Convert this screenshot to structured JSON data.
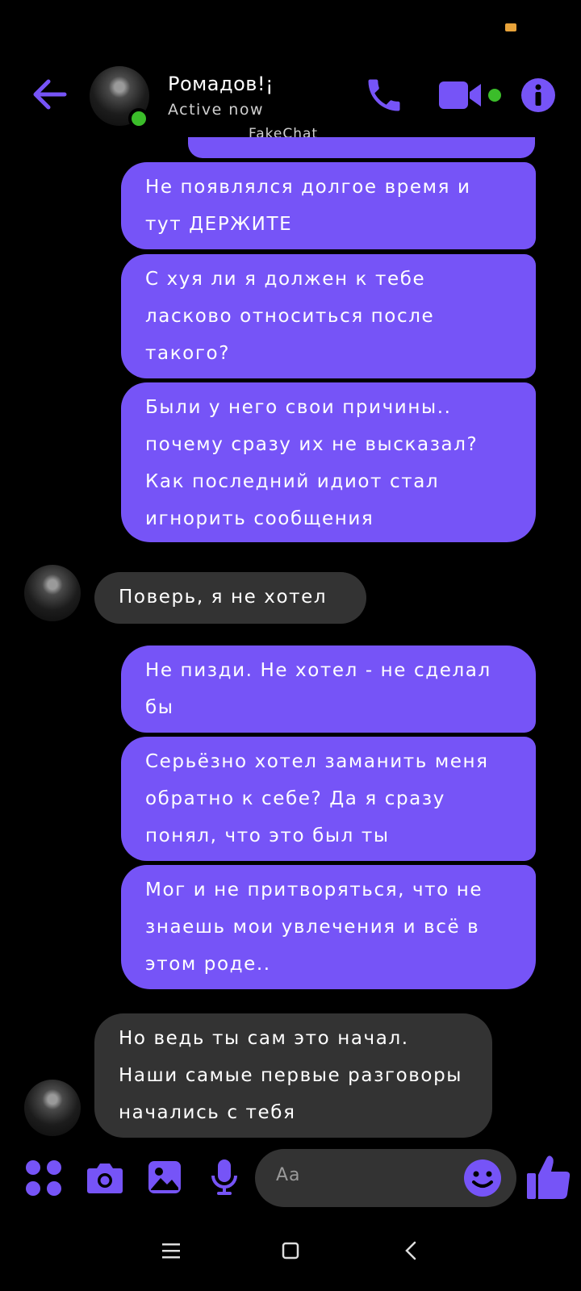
{
  "header": {
    "contact_name": "Ромадов!¡",
    "status": "Active now",
    "watermark": "FakeChat"
  },
  "messages": [
    {
      "side": "out",
      "text": "Не появлялся долгое время и тут ДЕРЖИТЕ"
    },
    {
      "side": "out",
      "text": "С хуя ли я должен к тебе ласково относиться после такого?"
    },
    {
      "side": "out",
      "text": "Были у него свои причины.. почему сразу их не высказал? Как последний идиот стал игнорить сообщения"
    },
    {
      "side": "in",
      "text": "Поверь, я не хотел"
    },
    {
      "side": "out",
      "text": "Не пизди. Не хотел - не сделал бы"
    },
    {
      "side": "out",
      "text": "Серьёзно хотел заманить меня обратно к себе? Да я сразу понял, что это был ты"
    },
    {
      "side": "out",
      "text": "Мог и не притворяться, что не знаешь мои увлечения и всё в этом роде.."
    },
    {
      "side": "in",
      "text": "Но ведь ты сам это начал. Наши самые первые разговоры начались с тебя"
    }
  ],
  "composer": {
    "placeholder": "Aa"
  },
  "colors": {
    "accent": "#7654f7",
    "incoming_bubble": "#333333",
    "online": "#3bbd2a",
    "background": "#000000"
  },
  "icons": [
    "back-arrow-icon",
    "phone-icon",
    "video-camera-icon",
    "info-icon",
    "apps-icon",
    "camera-icon",
    "gallery-icon",
    "microphone-icon",
    "emoji-icon",
    "thumbs-up-icon",
    "menu-icon",
    "home-icon",
    "back-nav-icon"
  ]
}
